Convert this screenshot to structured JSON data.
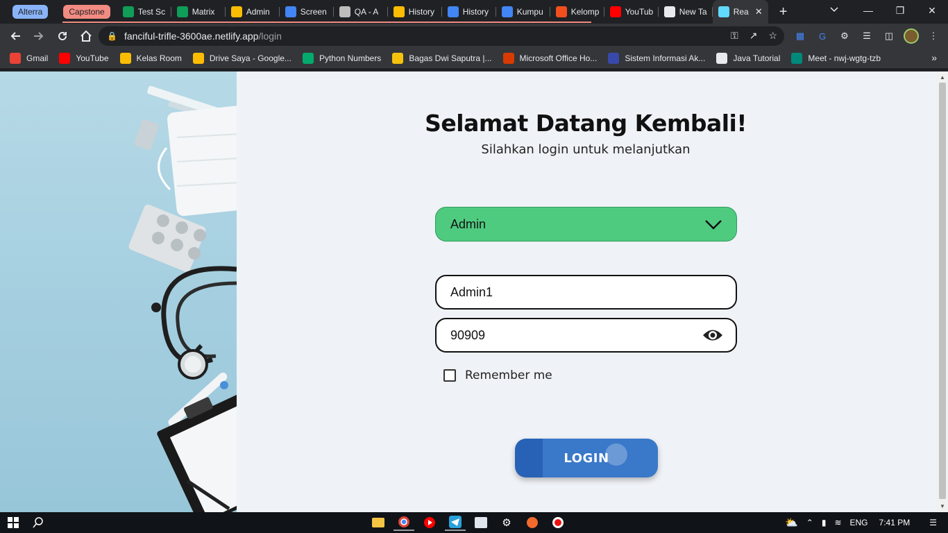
{
  "browser": {
    "tab_groups": [
      {
        "label": "Alterra",
        "color": "#8ab4f8"
      },
      {
        "label": "Capstone",
        "color": "#f28b82"
      }
    ],
    "tabs": [
      {
        "label": "Test Sc",
        "icon": "sheets-icon",
        "color": "#0f9d58"
      },
      {
        "label": "Matrix",
        "icon": "sheets-icon",
        "color": "#0f9d58"
      },
      {
        "label": "Admin",
        "icon": "drive-icon",
        "color": "#fbbc04"
      },
      {
        "label": "Screen",
        "icon": "docs-icon",
        "color": "#4285f4"
      },
      {
        "label": "QA - A",
        "icon": "trello-icon",
        "color": "#bdbdbd"
      },
      {
        "label": "History",
        "icon": "drive-icon",
        "color": "#fbbc04"
      },
      {
        "label": "History",
        "icon": "docs-icon",
        "color": "#4285f4"
      },
      {
        "label": "Kumpu",
        "icon": "docs-icon",
        "color": "#4285f4"
      },
      {
        "label": "Kelomp",
        "icon": "figma-icon",
        "color": "#f24e1e"
      },
      {
        "label": "YouTub",
        "icon": "youtube-icon",
        "color": "#ff0000"
      },
      {
        "label": "New Ta",
        "icon": "chrome-icon",
        "color": "#e8eaed"
      },
      {
        "label": "Rea",
        "icon": "react-icon",
        "color": "#61dafb",
        "active": true
      }
    ],
    "url_host": "fanciful-trifle-3600ae.netlify.app",
    "url_path": "/login",
    "bookmarks": [
      {
        "label": "Gmail",
        "icon": "gmail-icon",
        "color": "#ea4335"
      },
      {
        "label": "YouTube",
        "icon": "youtube-icon",
        "color": "#ff0000"
      },
      {
        "label": "Kelas Room",
        "icon": "classroom-icon",
        "color": "#fbbc04"
      },
      {
        "label": "Drive Saya - Google...",
        "icon": "drive-icon",
        "color": "#fbbc04"
      },
      {
        "label": "Python Numbers",
        "icon": "w3schools-icon",
        "color": "#04aa6d"
      },
      {
        "label": "Bagas Dwi Saputra |...",
        "icon": "elearning-icon",
        "color": "#f4c20d"
      },
      {
        "label": "Microsoft Office Ho...",
        "icon": "office-icon",
        "color": "#d83b01"
      },
      {
        "label": "Sistem Informasi Ak...",
        "icon": "university-icon",
        "color": "#3949ab"
      },
      {
        "label": "Java Tutorial",
        "icon": "java-icon",
        "color": "#e8eaed"
      },
      {
        "label": "Meet - nwj-wgtg-tzb",
        "icon": "meet-icon",
        "color": "#00897b"
      }
    ]
  },
  "login": {
    "title": "Selamat Datang Kembali!",
    "subtitle": "Silahkan login untuk melanjutkan",
    "role_selected": "Admin",
    "username_value": "Admin1",
    "password_value": "90909",
    "remember_label": "Remember me",
    "remember_checked": false,
    "login_button": "LOGIN",
    "accent_green": "#4fcb80",
    "accent_blue": "#3a78c9"
  },
  "taskbar": {
    "language": "ENG",
    "time": "7:41 PM"
  }
}
